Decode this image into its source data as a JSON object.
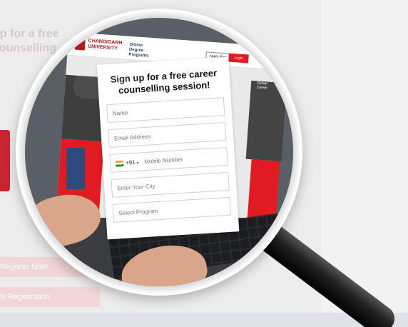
{
  "background": {
    "title": "up for a free counselling",
    "btn1": "Register Now",
    "btn2": "ly Registration"
  },
  "laptop": {
    "logo_line1": "CHANDIGARH",
    "logo_line2": "UNIVERSITY",
    "logo_sub": "Online Degree Programs",
    "apply_label": "Apply Now",
    "login_label": "Login",
    "side_note": "Global Career"
  },
  "form": {
    "title": "Sign up for a free career counselling session!",
    "name_placeholder": "Name",
    "email_placeholder": "Email Address",
    "country_code": "+91",
    "mobile_placeholder": "Mobile Number",
    "city_placeholder": "Enter Your City",
    "program_placeholder": "Select Program"
  },
  "colors": {
    "brand_red": "#e11b22",
    "handle": "#111111"
  }
}
